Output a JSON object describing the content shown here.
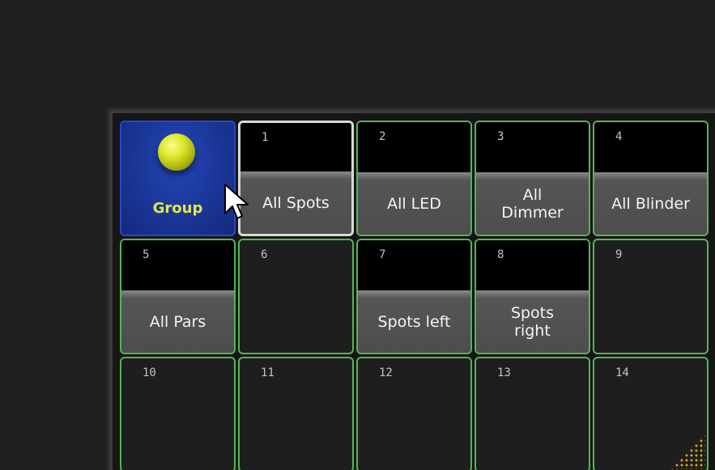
{
  "group_pool": {
    "title_cell": {
      "label": "Group",
      "icon": "yellow-sphere-icon"
    },
    "cells": [
      {
        "number": "1",
        "label": "All Spots",
        "state": "selected"
      },
      {
        "number": "2",
        "label": "All LED",
        "state": "stored"
      },
      {
        "number": "3",
        "label": "All\nDimmer",
        "state": "stored"
      },
      {
        "number": "4",
        "label": "All Blinder",
        "state": "stored"
      },
      {
        "number": "5",
        "label": "All Pars",
        "state": "stored"
      },
      {
        "number": "6",
        "label": "",
        "state": "empty"
      },
      {
        "number": "7",
        "label": "Spots left",
        "state": "stored"
      },
      {
        "number": "8",
        "label": "Spots\nright",
        "state": "stored"
      },
      {
        "number": "9",
        "label": "",
        "state": "empty"
      },
      {
        "number": "10",
        "label": "",
        "state": "empty"
      },
      {
        "number": "11",
        "label": "",
        "state": "empty"
      },
      {
        "number": "12",
        "label": "",
        "state": "empty"
      },
      {
        "number": "13",
        "label": "",
        "state": "empty"
      },
      {
        "number": "14",
        "label": "",
        "state": "empty"
      }
    ]
  },
  "colors": {
    "cell_border": "#55b455",
    "group_cell_bg": "#1a3596",
    "group_label": "#dfe84a",
    "selected_border": "#d8d8d8",
    "resize_grip": "#d1a11c"
  }
}
